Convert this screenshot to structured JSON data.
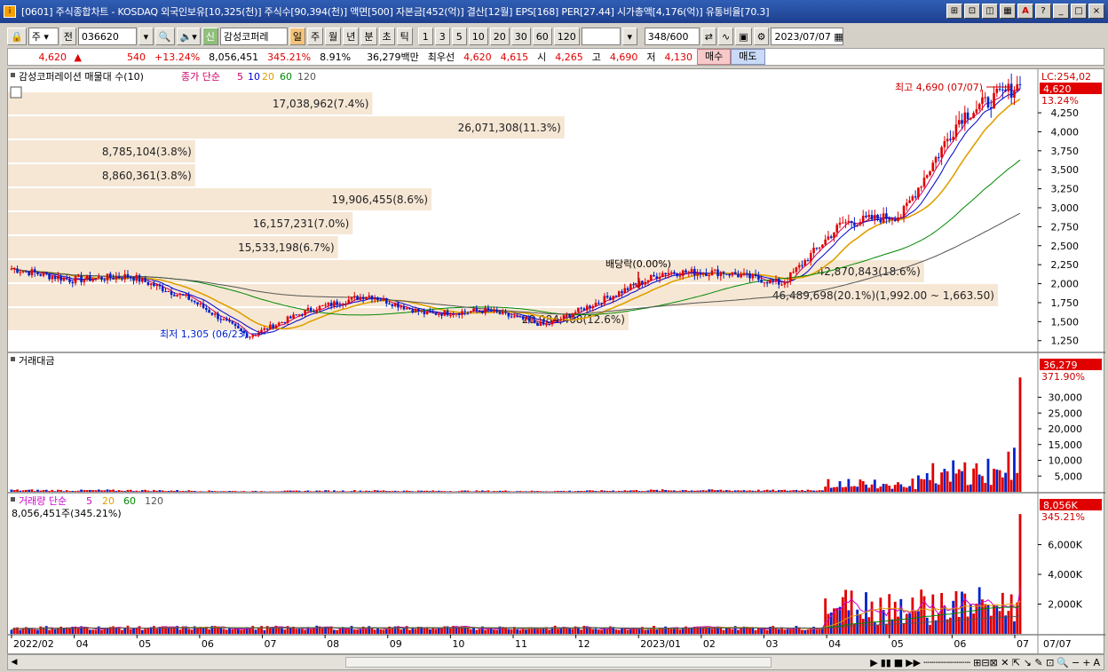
{
  "window": {
    "title": "[0601] 주식종합차트 - KOSDAQ 외국인보유[10,325(천)] 주식수[90,394(천)] 액면[500] 자본금[452(억)] 결산[12월] EPS[168] PER[27.44] 시가총액[4,176(억)] 유통비율[70.3]",
    "buttons": [
      "⊞",
      "⊡",
      "◫",
      "▦",
      "A",
      "?",
      "_",
      "□",
      "×"
    ]
  },
  "toolbar": {
    "type_select": "주",
    "prev_label": "전",
    "code": "036620",
    "stock_name": "감성코퍼레",
    "periods": [
      "일",
      "주",
      "월",
      "년",
      "분",
      "초",
      "틱"
    ],
    "intervals": [
      "1",
      "3",
      "5",
      "10",
      "20",
      "30",
      "60",
      "120"
    ],
    "count": "348",
    "count_total": "/600",
    "date": "2023/07/07"
  },
  "info": {
    "price": "4,620",
    "change": "540",
    "change_pct": "+13.24%",
    "volume": "8,056,451",
    "vol_ratio": "345.21%",
    "turnover": "8.91%",
    "amount": "36,279백만",
    "best_label": "최우선",
    "ask": "4,620",
    "bid": "4,615",
    "open_label": "시",
    "open": "4,265",
    "high_label": "고",
    "high": "4,690",
    "low_label": "저",
    "low": "4,130",
    "buy_label": "매수",
    "sell_label": "매도"
  },
  "price_panel": {
    "legend": "감성코퍼레이션 매물대 수(10)",
    "ma_label": "종가 단순",
    "ma_periods": [
      "5",
      "10",
      "20",
      "60",
      "120"
    ],
    "ma_colors": [
      "#cc0066",
      "#0000cc",
      "#e0a000",
      "#008800",
      "#555555"
    ],
    "lc_label": "LC:254,02",
    "last_price": "4,620",
    "last_pct": "13.24%",
    "high_note": "최고 4,690 (07/07)",
    "low_note": "최저 1,305 (06/23)",
    "dividend_note": "배당락(0.00%)",
    "volume_profile": [
      {
        "text": "17,038,962(7.4%)",
        "fraction": 0.074
      },
      {
        "text": "26,071,308(11.3%)",
        "fraction": 0.113
      },
      {
        "text": "8,785,104(3.8%)",
        "fraction": 0.038
      },
      {
        "text": "8,860,361(3.8%)",
        "fraction": 0.038
      },
      {
        "text": "19,906,455(8.6%)",
        "fraction": 0.086
      },
      {
        "text": "16,157,231(7.0%)",
        "fraction": 0.07
      },
      {
        "text": "15,533,198(6.7%)",
        "fraction": 0.067
      },
      {
        "text": "42,870,843(18.6%)",
        "fraction": 0.186
      },
      {
        "text": "46,489,698(20.1%)(1,992.00 ~ 1,663.50)",
        "fraction": 0.201
      },
      {
        "text": "28,984,408(12.6%)",
        "fraction": 0.126
      }
    ],
    "yticks": [
      "4,250",
      "4,000",
      "3,750",
      "3,500",
      "3,250",
      "3,000",
      "2,750",
      "2,500",
      "2,250",
      "2,000",
      "1,750",
      "1,500",
      "1,250"
    ]
  },
  "amount_panel": {
    "legend": "거래대금",
    "last_value": "36,279",
    "last_pct": "371.90%",
    "yticks": [
      "30,000",
      "25,000",
      "20,000",
      "15,000",
      "10,000",
      "5,000"
    ]
  },
  "volume_panel": {
    "legend": "거래량 단순",
    "ma_periods": [
      "5",
      "20",
      "60",
      "120"
    ],
    "value_text": "8,056,451주(345.21%)",
    "last_value": "8,056K",
    "last_pct": "345.21%",
    "yticks": [
      "6,000K",
      "4,000K",
      "2,000K"
    ]
  },
  "xaxis": {
    "labels": [
      "2022/02",
      "04",
      "05",
      "06",
      "07",
      "08",
      "09",
      "10",
      "11",
      "12",
      "2023/01",
      "02",
      "03",
      "04",
      "05",
      "06",
      "07"
    ],
    "right_label": "07/07"
  },
  "chart_data": {
    "type": "candlestick",
    "title": "감성코퍼레이션 매물대 수(10)",
    "x_range": [
      "2022/02",
      "2023/07/07"
    ],
    "ylim": [
      1200,
      4800
    ],
    "key_points": [
      {
        "date": "2022/02",
        "close": 2200
      },
      {
        "date": "2022/03",
        "close": 2050
      },
      {
        "date": "2022/04",
        "close": 2100
      },
      {
        "date": "2022/05",
        "close": 1800
      },
      {
        "date": "2022/06/23",
        "close": 1305
      },
      {
        "date": "2022/07",
        "close": 1650
      },
      {
        "date": "2022/08",
        "close": 1850
      },
      {
        "date": "2022/09",
        "close": 1600
      },
      {
        "date": "2022/10",
        "close": 1650
      },
      {
        "date": "2022/11",
        "close": 1450
      },
      {
        "date": "2022/12",
        "close": 1800
      },
      {
        "date": "2023/01",
        "close": 2150
      },
      {
        "date": "2023/02",
        "close": 2150
      },
      {
        "date": "2023/03",
        "close": 2000
      },
      {
        "date": "2023/04",
        "close": 2800
      },
      {
        "date": "2023/05",
        "close": 2900
      },
      {
        "date": "2023/06",
        "close": 4200
      },
      {
        "date": "2023/07/07",
        "close": 4620
      }
    ],
    "high": {
      "value": 4690,
      "date": "07/07"
    },
    "low": {
      "value": 1305,
      "date": "06/23"
    },
    "last": 4620
  }
}
